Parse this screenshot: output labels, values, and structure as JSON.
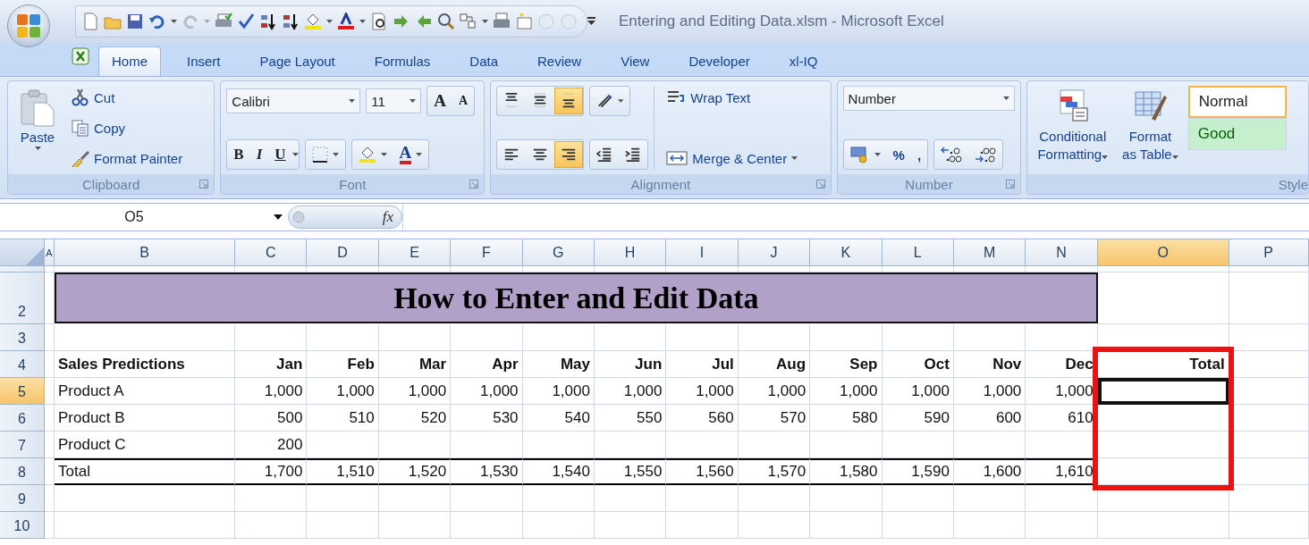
{
  "window": {
    "title": "Entering and Editing Data.xlsm - Microsoft Excel"
  },
  "tabs": [
    {
      "label": "Home",
      "selected": true
    },
    {
      "label": "Insert",
      "selected": false
    },
    {
      "label": "Page Layout",
      "selected": false
    },
    {
      "label": "Formulas",
      "selected": false
    },
    {
      "label": "Data",
      "selected": false
    },
    {
      "label": "Review",
      "selected": false
    },
    {
      "label": "View",
      "selected": false
    },
    {
      "label": "Developer",
      "selected": false
    },
    {
      "label": "xl-IQ",
      "selected": false
    }
  ],
  "ribbon": {
    "groups": [
      {
        "kind": "clipboard",
        "label": "Clipboard",
        "paste": "Paste",
        "commands": [
          "Cut",
          "Copy",
          "Format Painter"
        ]
      },
      {
        "kind": "font",
        "label": "Font",
        "font": "Calibri",
        "size": "11",
        "grow": "A",
        "shrink": "A",
        "styles": [
          "B",
          "I",
          "U"
        ],
        "font_color": "A"
      },
      {
        "kind": "alignment",
        "label": "Alignment",
        "align_buttons": [
          {
            "selected": false
          },
          {
            "selected": false
          },
          {
            "selected": true
          },
          {
            "selected": false
          },
          {
            "selected": false
          },
          {
            "selected": true
          }
        ],
        "wrap": "Wrap Text",
        "merge": "Merge & Center"
      },
      {
        "kind": "number",
        "label": "Number",
        "format": "Number",
        "percent": "%",
        "comma": ","
      },
      {
        "kind": "styles",
        "label": "Style",
        "commands": [
          "Conditional Formatting",
          "Format as Table"
        ],
        "cell_styles": [
          {
            "text": "Normal",
            "kind": "normal"
          },
          {
            "text": "Good",
            "kind": "good"
          }
        ]
      }
    ]
  },
  "formula_bar": {
    "name_box": "O5",
    "function_label": "fx"
  },
  "sheet": {
    "columns": [
      {
        "label": "A",
        "selected": false
      },
      {
        "label": "B",
        "selected": false
      },
      {
        "label": "C",
        "selected": false
      },
      {
        "label": "D",
        "selected": false
      },
      {
        "label": "E",
        "selected": false
      },
      {
        "label": "F",
        "selected": false
      },
      {
        "label": "G",
        "selected": false
      },
      {
        "label": "H",
        "selected": false
      },
      {
        "label": "I",
        "selected": false
      },
      {
        "label": "J",
        "selected": false
      },
      {
        "label": "K",
        "selected": false
      },
      {
        "label": "L",
        "selected": false
      },
      {
        "label": "M",
        "selected": false
      },
      {
        "label": "N",
        "selected": false
      },
      {
        "label": "O",
        "selected": true
      },
      {
        "label": "P",
        "selected": false
      }
    ],
    "rows": [
      {
        "label": "2",
        "selected": false,
        "kind": "title",
        "text": "How to Enter and Edit Data"
      },
      {
        "label": "3",
        "selected": false,
        "kind": "blank"
      },
      {
        "label": "4",
        "selected": false,
        "kind": "header",
        "name": "Sales Predictions",
        "values": [
          "Jan",
          "Feb",
          "Mar",
          "Apr",
          "May",
          "Jun",
          "Jul",
          "Aug",
          "Sep",
          "Oct",
          "Nov",
          "Dec"
        ],
        "total": "Total"
      },
      {
        "label": "5",
        "selected": true,
        "kind": "data",
        "name": "Product A",
        "values": [
          "1,000",
          "1,000",
          "1,000",
          "1,000",
          "1,000",
          "1,000",
          "1,000",
          "1,000",
          "1,000",
          "1,000",
          "1,000",
          "1,000"
        ]
      },
      {
        "label": "6",
        "selected": false,
        "kind": "data",
        "name": "Product B",
        "values": [
          "500",
          "510",
          "520",
          "530",
          "540",
          "550",
          "560",
          "570",
          "580",
          "590",
          "600",
          "610"
        ]
      },
      {
        "label": "7",
        "selected": false,
        "kind": "data",
        "name": "Product C",
        "values": [
          "200"
        ]
      },
      {
        "label": "8",
        "selected": false,
        "kind": "total",
        "name": "Total",
        "values": [
          "1,700",
          "1,510",
          "1,520",
          "1,530",
          "1,540",
          "1,550",
          "1,560",
          "1,570",
          "1,580",
          "1,590",
          "1,600",
          "1,610"
        ]
      },
      {
        "label": "9",
        "selected": false,
        "kind": "blank"
      },
      {
        "label": "10",
        "selected": false,
        "kind": "blank"
      }
    ]
  }
}
